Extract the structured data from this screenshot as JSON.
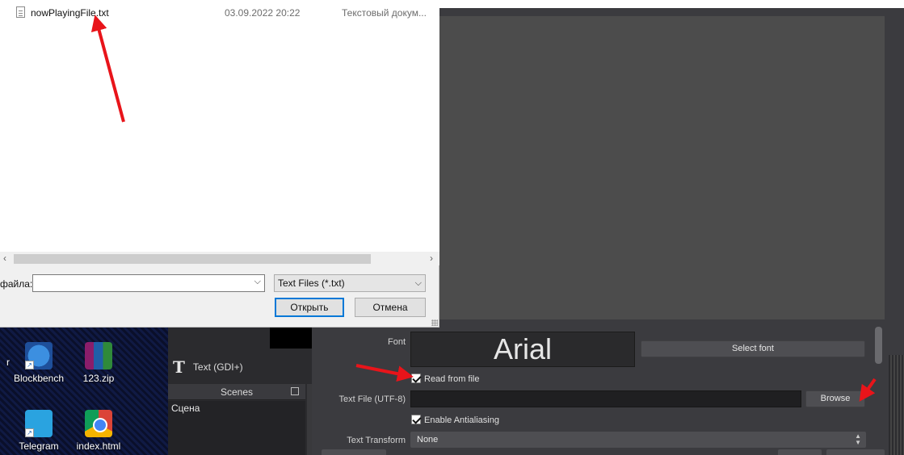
{
  "file_dialog": {
    "file": {
      "name": "nowPlayingFile.txt",
      "date": "03.09.2022 20:22",
      "type": "Текстовый докум..."
    },
    "filename_label": "файла:",
    "filename_value": "",
    "filter_value": "Text Files (*.txt)",
    "open_label": "Открыть",
    "cancel_label": "Отмена"
  },
  "desktop": {
    "icons": [
      {
        "label": "Blockbench",
        "icon": "blockbench-icon"
      },
      {
        "label": "123.zip",
        "icon": "winrar-archive-icon"
      },
      {
        "label": "Telegram",
        "icon": "telegram-icon"
      },
      {
        "label": "index.html",
        "icon": "chrome-icon"
      }
    ],
    "edge_label": "r"
  },
  "obs": {
    "source_name": "Text (GDI+)",
    "scenes_header": "Scenes",
    "scene_item": "Сцена",
    "properties": {
      "font_label": "Font",
      "font_preview": "Arial",
      "select_font_label": "Select font",
      "read_from_file_label": "Read from file",
      "read_from_file_checked": true,
      "text_file_label": "Text File (UTF-8)",
      "text_file_value": "",
      "browse_label": "Browse",
      "antialiasing_label": "Enable Antialiasing",
      "antialiasing_checked": true,
      "text_transform_label": "Text Transform",
      "text_transform_value": "None"
    }
  },
  "colors": {
    "annotation_arrow": "#e8141a",
    "obs_panel": "#3b3b3f",
    "obs_preview": "#4c4c4c",
    "dialog_primary_border": "#0078d7"
  }
}
